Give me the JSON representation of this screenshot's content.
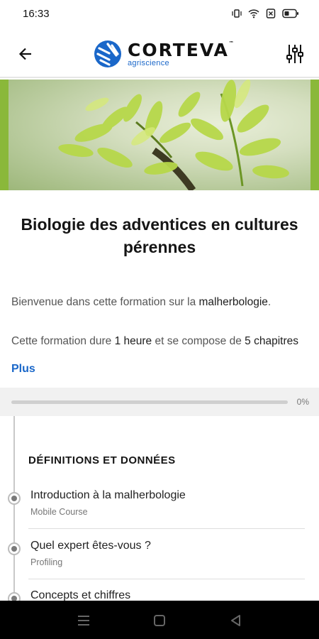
{
  "status_bar": {
    "time": "16:33",
    "icons": [
      "vibrate-icon",
      "wifi-icon",
      "sim-off-icon",
      "battery-icon"
    ]
  },
  "app_bar": {
    "brand": "CORTEVA",
    "brand_mark": "™",
    "brand_sub": "agriscience"
  },
  "course": {
    "title": "Biologie des adventices en cultures pérennes",
    "desc1_pre": "Bienvenue dans cette formation sur la ",
    "desc1_bold": "malherbologie",
    "desc1_post": ".",
    "desc2_pre": "Cette formation dure ",
    "desc2_bold1": "1 heure",
    "desc2_mid": " et se compose de ",
    "desc2_bold2": "5 chapitres",
    "more_label": "Plus"
  },
  "progress": {
    "value": 0,
    "label": "0%"
  },
  "section": {
    "title": "DÉFINITIONS ET DONNÉES"
  },
  "items": [
    {
      "title": "Introduction à la malherbologie",
      "type": "Mobile Course"
    },
    {
      "title": "Quel expert êtes-vous ?",
      "type": "Profiling"
    },
    {
      "title": "Concepts et chiffres",
      "type": ""
    }
  ],
  "colors": {
    "accent": "#1a67c9",
    "hero_green": "#8ab83a"
  }
}
